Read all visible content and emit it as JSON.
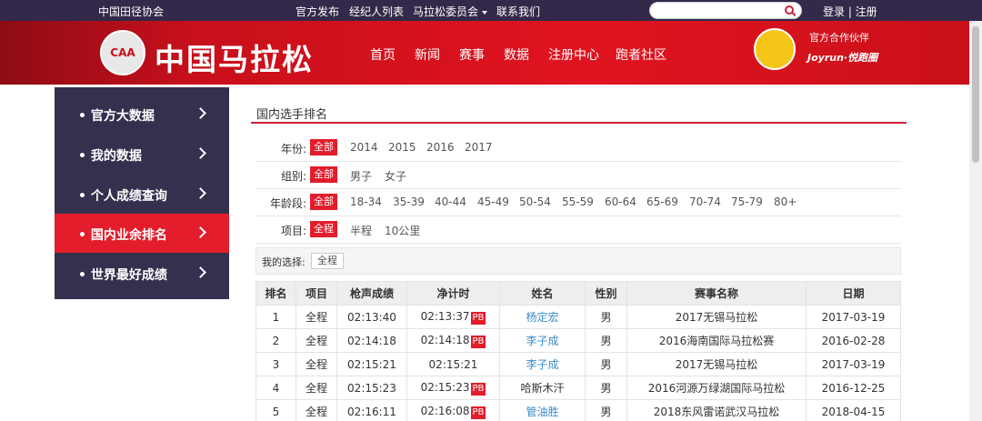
{
  "topbar": {
    "org": "中国田径协会",
    "links": [
      "官方发布",
      "经纪人列表",
      "马拉松委员会",
      "联系我们"
    ],
    "auth": "登录 | 注册",
    "search_placeholder": ""
  },
  "header": {
    "logo_badge": "CAA",
    "logo_text": "中国马拉松",
    "nav": [
      "首页",
      "新闻",
      "赛事",
      "数据",
      "注册中心",
      "跑者社区"
    ],
    "partner_label": "官方合作伙伴",
    "partner_name": "Joyrun·悦跑圈"
  },
  "sidebar": {
    "items": [
      {
        "label": "官方大数据",
        "active": false
      },
      {
        "label": "我的数据",
        "active": false
      },
      {
        "label": "个人成绩查询",
        "active": false
      },
      {
        "label": "国内业余排名",
        "active": true
      },
      {
        "label": "世界最好成绩",
        "active": false
      }
    ]
  },
  "main": {
    "title": "国内选手排名",
    "filters": {
      "year": {
        "label": "年份:",
        "selected": "全部",
        "options": [
          "2014",
          "2015",
          "2016",
          "2017"
        ]
      },
      "group": {
        "label": "组别:",
        "selected": "全部",
        "options": [
          "男子",
          "女子"
        ]
      },
      "age": {
        "label": "年龄段:",
        "selected": "全部",
        "options": [
          "18-34",
          "35-39",
          "40-44",
          "45-49",
          "50-54",
          "55-59",
          "60-64",
          "65-69",
          "70-74",
          "75-79",
          "80+"
        ]
      },
      "event": {
        "label": "项目:",
        "selected": "全程",
        "options": [
          "半程",
          "10公里"
        ]
      }
    },
    "my_choice": {
      "label": "我的选择:",
      "tag": "全程"
    },
    "table": {
      "headers": [
        "排名",
        "项目",
        "枪声成绩",
        "净计时",
        "姓名",
        "性别",
        "赛事名称",
        "日期"
      ],
      "pb_label": "PB",
      "rows": [
        {
          "rank": "1",
          "event": "全程",
          "gun": "02:13:40",
          "net": "02:13:37",
          "pb": true,
          "name": "杨定宏",
          "gender": "男",
          "race": "2017无锡马拉松",
          "date": "2017-03-19"
        },
        {
          "rank": "2",
          "event": "全程",
          "gun": "02:14:18",
          "net": "02:14:18",
          "pb": true,
          "name": "李子成",
          "gender": "男",
          "race": "2016海南国际马拉松赛",
          "date": "2016-02-28"
        },
        {
          "rank": "3",
          "event": "全程",
          "gun": "02:15:21",
          "net": "02:15:21",
          "pb": false,
          "name": "李子成",
          "gender": "男",
          "race": "2017无锡马拉松",
          "date": "2017-03-19"
        },
        {
          "rank": "4",
          "event": "全程",
          "gun": "02:15:23",
          "net": "02:15:23",
          "pb": true,
          "name": "哈斯木汗",
          "gender": "男",
          "race": "2016河源万绿湖国际马拉松",
          "date": "2016-12-25"
        },
        {
          "rank": "5",
          "event": "全程",
          "gun": "02:16:11",
          "net": "02:16:08",
          "pb": true,
          "name": "管油胜",
          "gender": "男",
          "race": "2018东风雷诺武汉马拉松",
          "date": "2018-04-15"
        }
      ]
    }
  },
  "colors": {
    "accent": "#e31d2b",
    "topbar": "#33294a",
    "sidebar": "#35304e",
    "link": "#3a8dc8"
  }
}
